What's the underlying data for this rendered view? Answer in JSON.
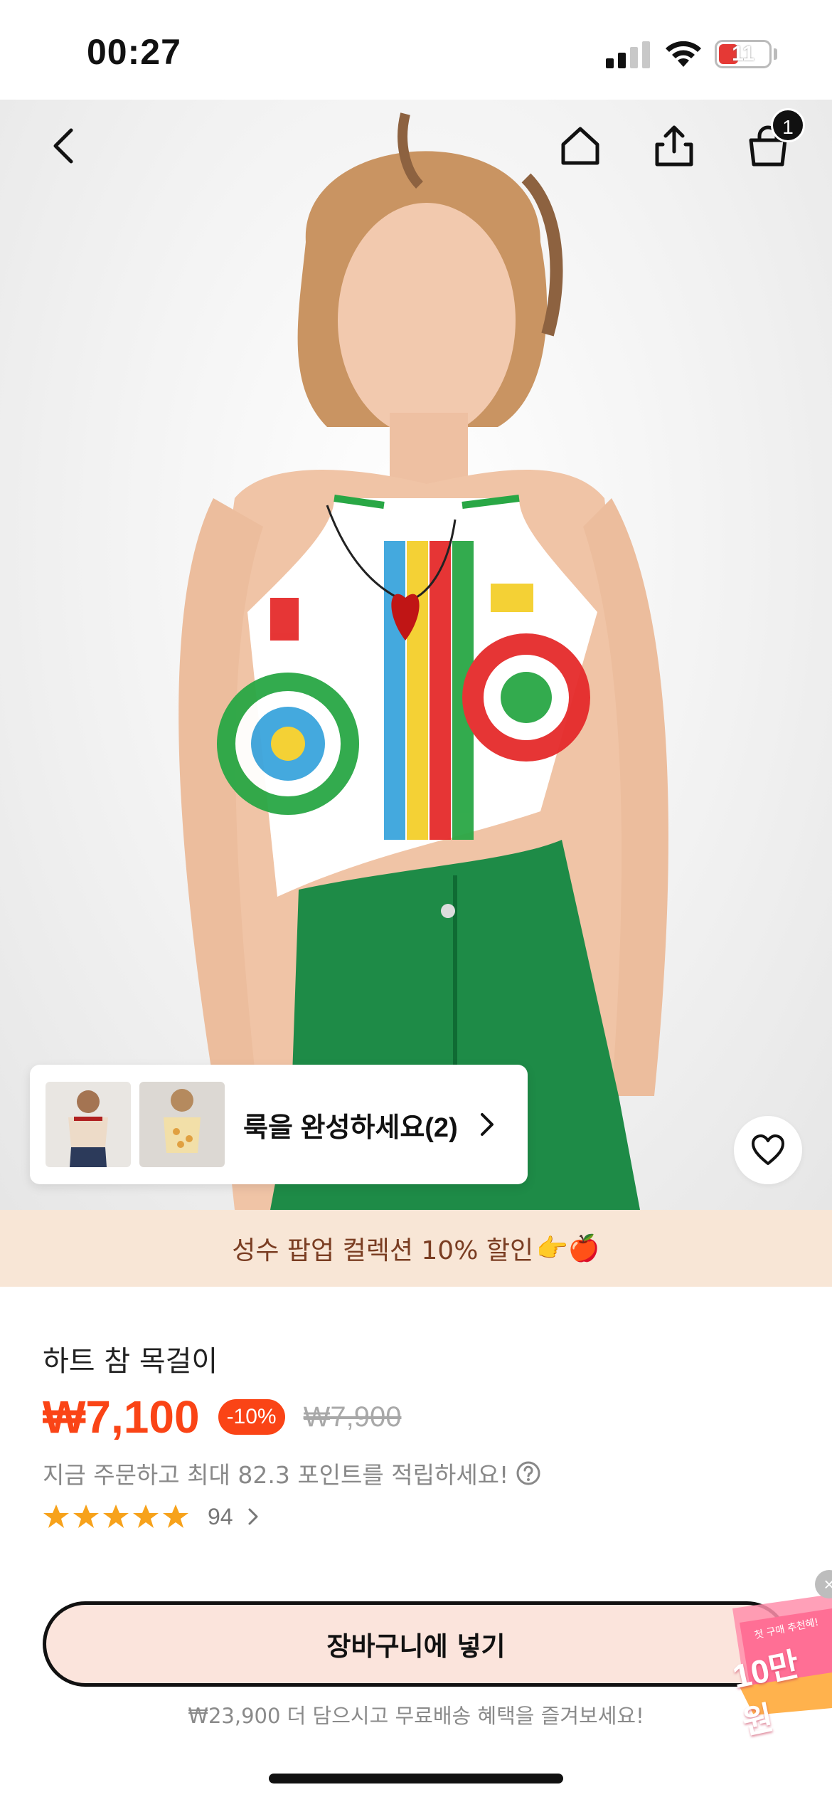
{
  "status_bar": {
    "time": "00:27",
    "battery_level": "11"
  },
  "nav": {
    "back_icon": "chevron-left-icon",
    "home_icon": "home-icon",
    "share_icon": "share-icon",
    "cart_icon": "shopping-bag-icon",
    "cart_count": "1"
  },
  "look_card": {
    "label": "룩을 완성하세요(2)"
  },
  "promo": {
    "text": "성수 팝업 컬렉션 10% 할인",
    "emoji": "👉🍎"
  },
  "product": {
    "title": "하트 참 목걸이",
    "price": "₩7,100",
    "discount": "-10%",
    "original_price": "₩7,900",
    "points_text": "지금 주문하고 최대 82.3 포인트를 적립하세요!",
    "rating_stars": 5,
    "rating_count": "94"
  },
  "actions": {
    "add_to_cart": "장바구니에 넣기",
    "free_shipping": "₩23,900 더 담으시고 무료배송 혜택을 즐겨보세요!"
  },
  "coupon": {
    "amount": "10만원",
    "subtitle": "첫 구매 추천혜!",
    "close": "×"
  },
  "colors": {
    "accent": "#fa4416",
    "promo_bg": "#f8e6d6",
    "promo_text": "#7a3d22",
    "cart_btn_bg": "#fbe4dc",
    "star": "#f7a21b"
  }
}
